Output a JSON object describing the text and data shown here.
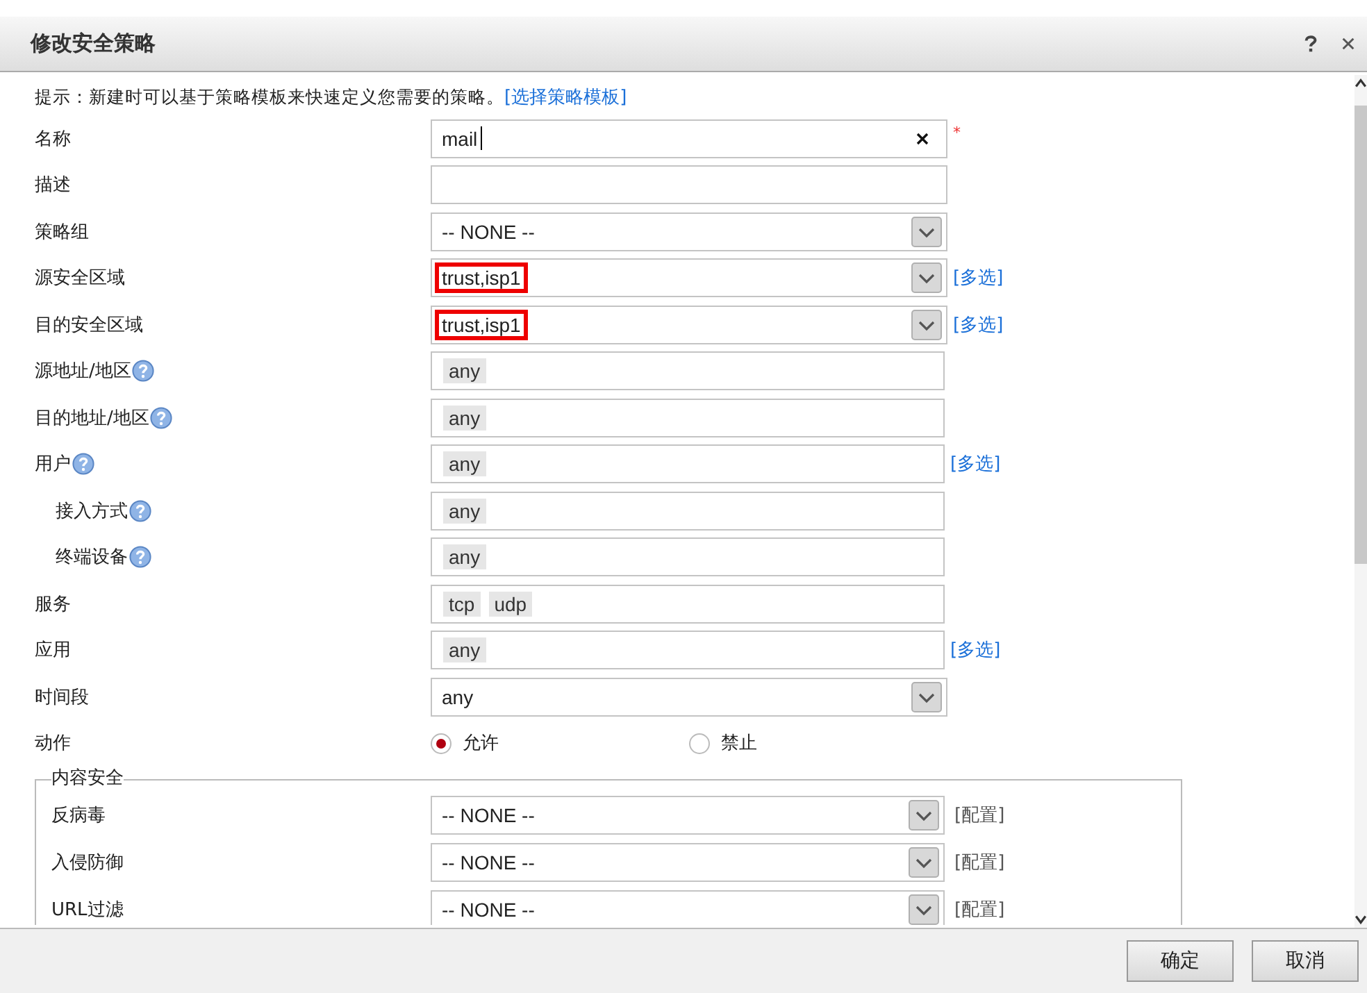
{
  "window": {
    "title": "修改安全策略"
  },
  "hint": {
    "text": "提示：新建时可以基于策略模板来快速定义您需要的策略。",
    "link": "[选择策略模板]"
  },
  "fields": [
    {
      "kind": "input",
      "label": "名称",
      "value": "mail",
      "clearable": true,
      "required_mark": "*"
    },
    {
      "kind": "input",
      "label": "描述"
    },
    {
      "kind": "select",
      "label": "策略组",
      "value": "-- NONE --"
    },
    {
      "kind": "select",
      "label": "源安全区域",
      "value": "trust,isp1",
      "highlighted": true,
      "link": "[多选]"
    },
    {
      "kind": "select",
      "label": "目的安全区域",
      "value": "trust,isp1",
      "highlighted": true,
      "link": "[多选]"
    },
    {
      "kind": "tags",
      "label": "源地址/地区",
      "help": true,
      "tags": [
        "any"
      ]
    },
    {
      "kind": "tags",
      "label": "目的地址/地区",
      "help": true,
      "tags": [
        "any"
      ]
    },
    {
      "kind": "tags",
      "label": "用户",
      "help": true,
      "tags": [
        "any"
      ],
      "link": "[多选]"
    },
    {
      "kind": "tags",
      "label": "接入方式",
      "help": true,
      "indented": true,
      "tags": [
        "any"
      ]
    },
    {
      "kind": "tags",
      "label": "终端设备",
      "help": true,
      "indented": true,
      "tags": [
        "any"
      ]
    },
    {
      "kind": "tags",
      "label": "服务",
      "tags": [
        "tcp",
        "udp"
      ]
    },
    {
      "kind": "tags",
      "label": "应用",
      "tags": [
        "any"
      ],
      "link": "[多选]"
    },
    {
      "kind": "select",
      "label": "时间段",
      "value": "any"
    },
    {
      "kind": "radio",
      "label": "动作",
      "options": [
        {
          "label": "允许",
          "selected": true
        },
        {
          "label": "禁止",
          "selected": false
        }
      ]
    }
  ],
  "content_security": {
    "legend": "内容安全",
    "rows": [
      {
        "label": "反病毒",
        "value": "-- NONE --",
        "link": "[配置]"
      },
      {
        "label": "入侵防御",
        "value": "-- NONE --",
        "link": "[配置]"
      },
      {
        "label": "URL过滤",
        "value": "-- NONE --",
        "link": "[配置]"
      }
    ]
  },
  "buttons": [
    "确定",
    "取消"
  ]
}
